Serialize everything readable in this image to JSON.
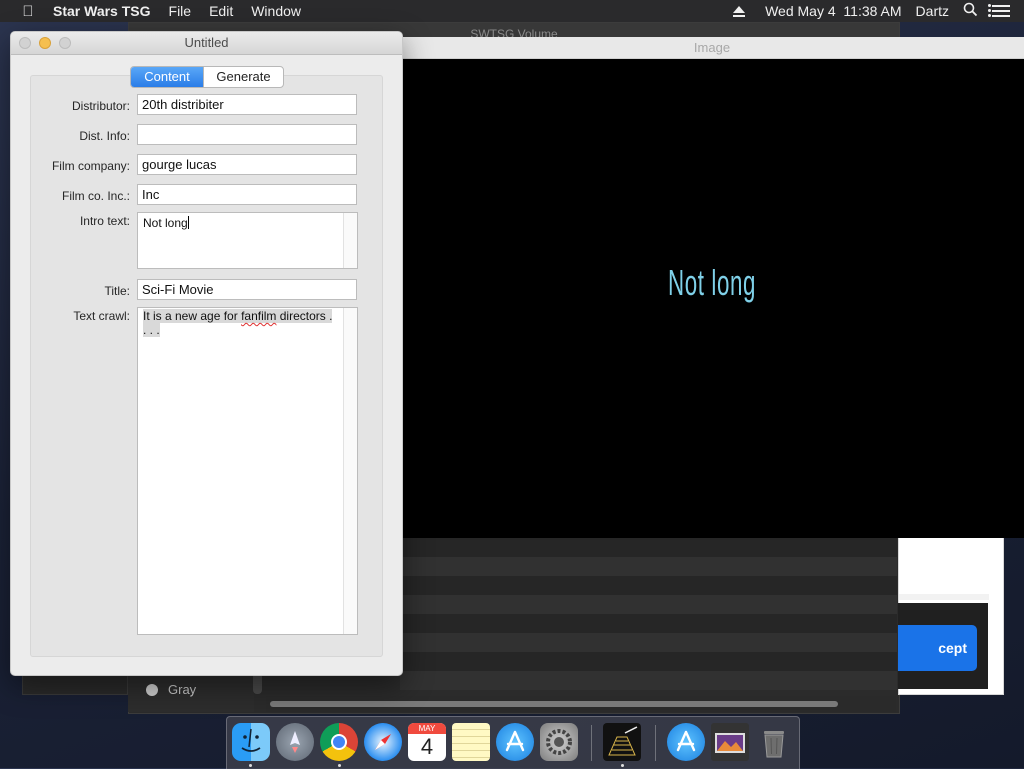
{
  "menubar": {
    "app_name": "Star Wars TSG",
    "menus": [
      "File",
      "Edit",
      "Window"
    ],
    "datetime": "Wed May 4  11:38 AM",
    "user": "Dartz"
  },
  "background": {
    "volume_window_title": "SWTSG Volume",
    "list_item": "Gray",
    "accept_label": "cept"
  },
  "image_window": {
    "title": "Image",
    "rendered_text": "Not long"
  },
  "main_window": {
    "title": "Untitled",
    "tabs": [
      {
        "label": "Content",
        "selected": true
      },
      {
        "label": "Generate",
        "selected": false
      }
    ],
    "fields": {
      "distributor": {
        "label": "Distributor:",
        "value": "20th distribiter"
      },
      "dist_info": {
        "label": "Dist. Info:",
        "value": ""
      },
      "film_company": {
        "label": "Film company:",
        "value": "gourge lucas"
      },
      "film_co_inc": {
        "label": "Film co. Inc.:",
        "value": "Inc"
      },
      "intro_text": {
        "label": "Intro text:",
        "value": "Not long"
      },
      "title": {
        "label": "Title:",
        "value": "Sci-Fi Movie"
      },
      "text_crawl": {
        "label": "Text crawl:",
        "value_part1": "It is a new age for ",
        "value_misspelled": "fanfilm",
        "value_part2": " directors . . . ."
      }
    }
  },
  "dock": {
    "calendar_month": "MAY",
    "calendar_day": "4",
    "icons": [
      "finder-icon",
      "launchpad-icon",
      "chrome-icon",
      "safari-icon",
      "calendar-icon",
      "notes-icon",
      "app-store-icon",
      "system-preferences-icon",
      "star-wars-tsg-icon",
      "app-store-icon",
      "photo-viewer-icon",
      "trash-icon"
    ]
  },
  "colors": {
    "accent": "#2a7de8",
    "caption": "#7fd0e8",
    "minimize": "#f5bf4f"
  }
}
